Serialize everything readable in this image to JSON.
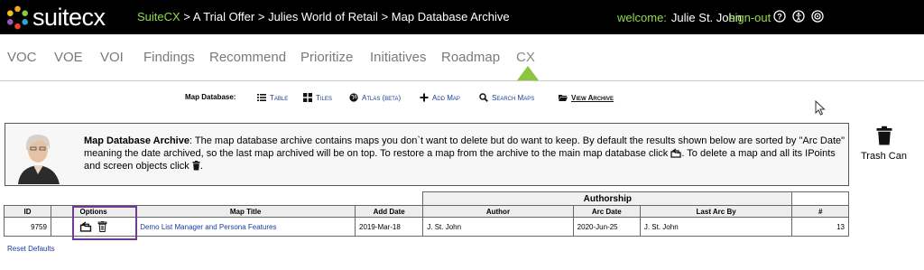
{
  "brand": {
    "name": "suitecx"
  },
  "breadcrumb": {
    "items": [
      "SuiteCX",
      "A Trial Offer",
      "Julies World of Retail",
      "Map Database Archive"
    ],
    "separator": " > "
  },
  "header": {
    "welcome_label": "welcome:",
    "user_name": "Julie St. John",
    "signout_label": "sign-out",
    "icons": [
      "help-icon",
      "accessibility-icon",
      "settings-icon"
    ]
  },
  "nav": {
    "tabs": [
      "VOC",
      "VOE",
      "VOI",
      "Findings",
      "Recommend",
      "Prioritize",
      "Initiatives",
      "Roadmap",
      "CX"
    ],
    "active": "CX",
    "accent": "#8cc63f"
  },
  "map_toolbar": {
    "label": "Map Database:",
    "items": [
      {
        "label": "Table",
        "icon": "list-icon"
      },
      {
        "label": "Tiles",
        "icon": "tiles-icon"
      },
      {
        "label": "Atlas (βeta)",
        "icon": "globe-icon"
      },
      {
        "label": "Add Map",
        "icon": "plus-icon"
      },
      {
        "label": "Search Maps",
        "icon": "search-icon"
      },
      {
        "label": "View Archive",
        "icon": "folder-open-icon"
      }
    ]
  },
  "archive_info": {
    "title": "Map Database Archive",
    "text1": ": The map database archive contains maps you don`t want to delete but do want to keep. By default the results shown below are sorted by \"Arc Date\" meaning the date archived, so the last map archived will be on top. To restore a map from the archive to the main map database click",
    "text2": ". To delete a map and all its IPoints and screen objects click",
    "text3": "."
  },
  "trash": {
    "label": "Trash Can"
  },
  "table": {
    "group_header": "Authorship",
    "columns": [
      "ID",
      "Options",
      "Map Title",
      "Add Date",
      "Author",
      "Arc Date",
      "Last Arc By",
      "#"
    ],
    "rows": [
      {
        "id": "9759",
        "title": "Demo List Manager and Persona Features",
        "add_date": "2019-Mar-18",
        "author": "J. St. John",
        "arc_date": "2020-Jun-25",
        "last_arc_by": "J. St. John",
        "count": "13"
      }
    ]
  },
  "reset_label": "Reset Defaults",
  "colors": {
    "link": "#1a3c9e",
    "green": "#8fdc4a",
    "highlight": "#6f3d96"
  }
}
